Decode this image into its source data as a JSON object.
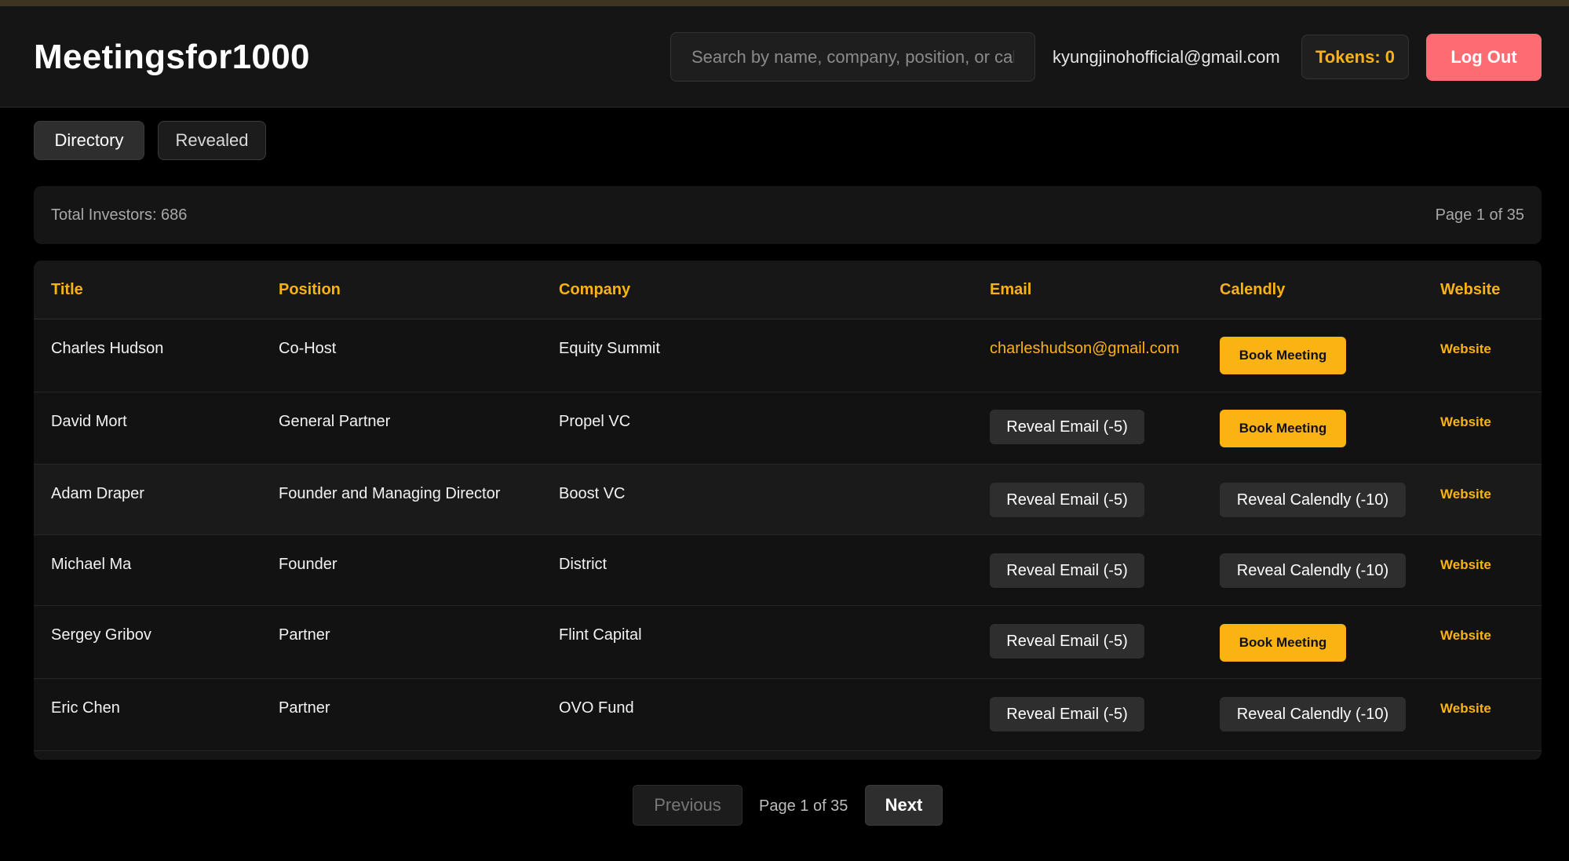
{
  "header": {
    "app_title": "Meetingsfor1000",
    "search_placeholder": "Search by name, company, position, or calendly",
    "user_email": "kyungjinohofficial@gmail.com",
    "tokens_label": "Tokens: 0",
    "logout_label": "Log Out"
  },
  "tabs": [
    {
      "label": "Directory",
      "active": true
    },
    {
      "label": "Revealed",
      "active": false
    }
  ],
  "stats": {
    "total_label": "Total Investors: 686",
    "page_label": "Page 1 of 35"
  },
  "table": {
    "columns": [
      "Title",
      "Position",
      "Company",
      "Email",
      "Calendly",
      "Website"
    ],
    "rows": [
      {
        "title": "Charles Hudson",
        "position": "Co-Host",
        "company": "Equity Summit",
        "email": "charleshudson@gmail.com",
        "email_action": "",
        "calendly_action": "Book Meeting",
        "website": "Website"
      },
      {
        "title": "David Mort",
        "position": "General Partner",
        "company": "Propel VC",
        "email": "",
        "email_action": "Reveal Email (-5)",
        "calendly_action": "Book Meeting",
        "website": "Website"
      },
      {
        "title": "Adam Draper",
        "position": "Founder and Managing Director",
        "company": "Boost VC",
        "email": "",
        "email_action": "Reveal Email (-5)",
        "calendly_action": "Reveal Calendly (-10)",
        "website": "Website"
      },
      {
        "title": "Michael Ma",
        "position": "Founder",
        "company": "District",
        "email": "",
        "email_action": "Reveal Email (-5)",
        "calendly_action": "Reveal Calendly (-10)",
        "website": "Website"
      },
      {
        "title": "Sergey Gribov",
        "position": "Partner",
        "company": "Flint Capital",
        "email": "",
        "email_action": "Reveal Email (-5)",
        "calendly_action": "Book Meeting",
        "website": "Website"
      },
      {
        "title": "Eric Chen",
        "position": "Partner",
        "company": "OVO Fund",
        "email": "",
        "email_action": "Reveal Email (-5)",
        "calendly_action": "Reveal Calendly (-10)",
        "website": "Website"
      }
    ]
  },
  "pagination": {
    "previous_label": "Previous",
    "page_label": "Page 1 of 35",
    "next_label": "Next"
  },
  "colors": {
    "accent": "#fbb313",
    "logout": "#ff6b72",
    "background": "#000000",
    "surface": "#151515"
  }
}
